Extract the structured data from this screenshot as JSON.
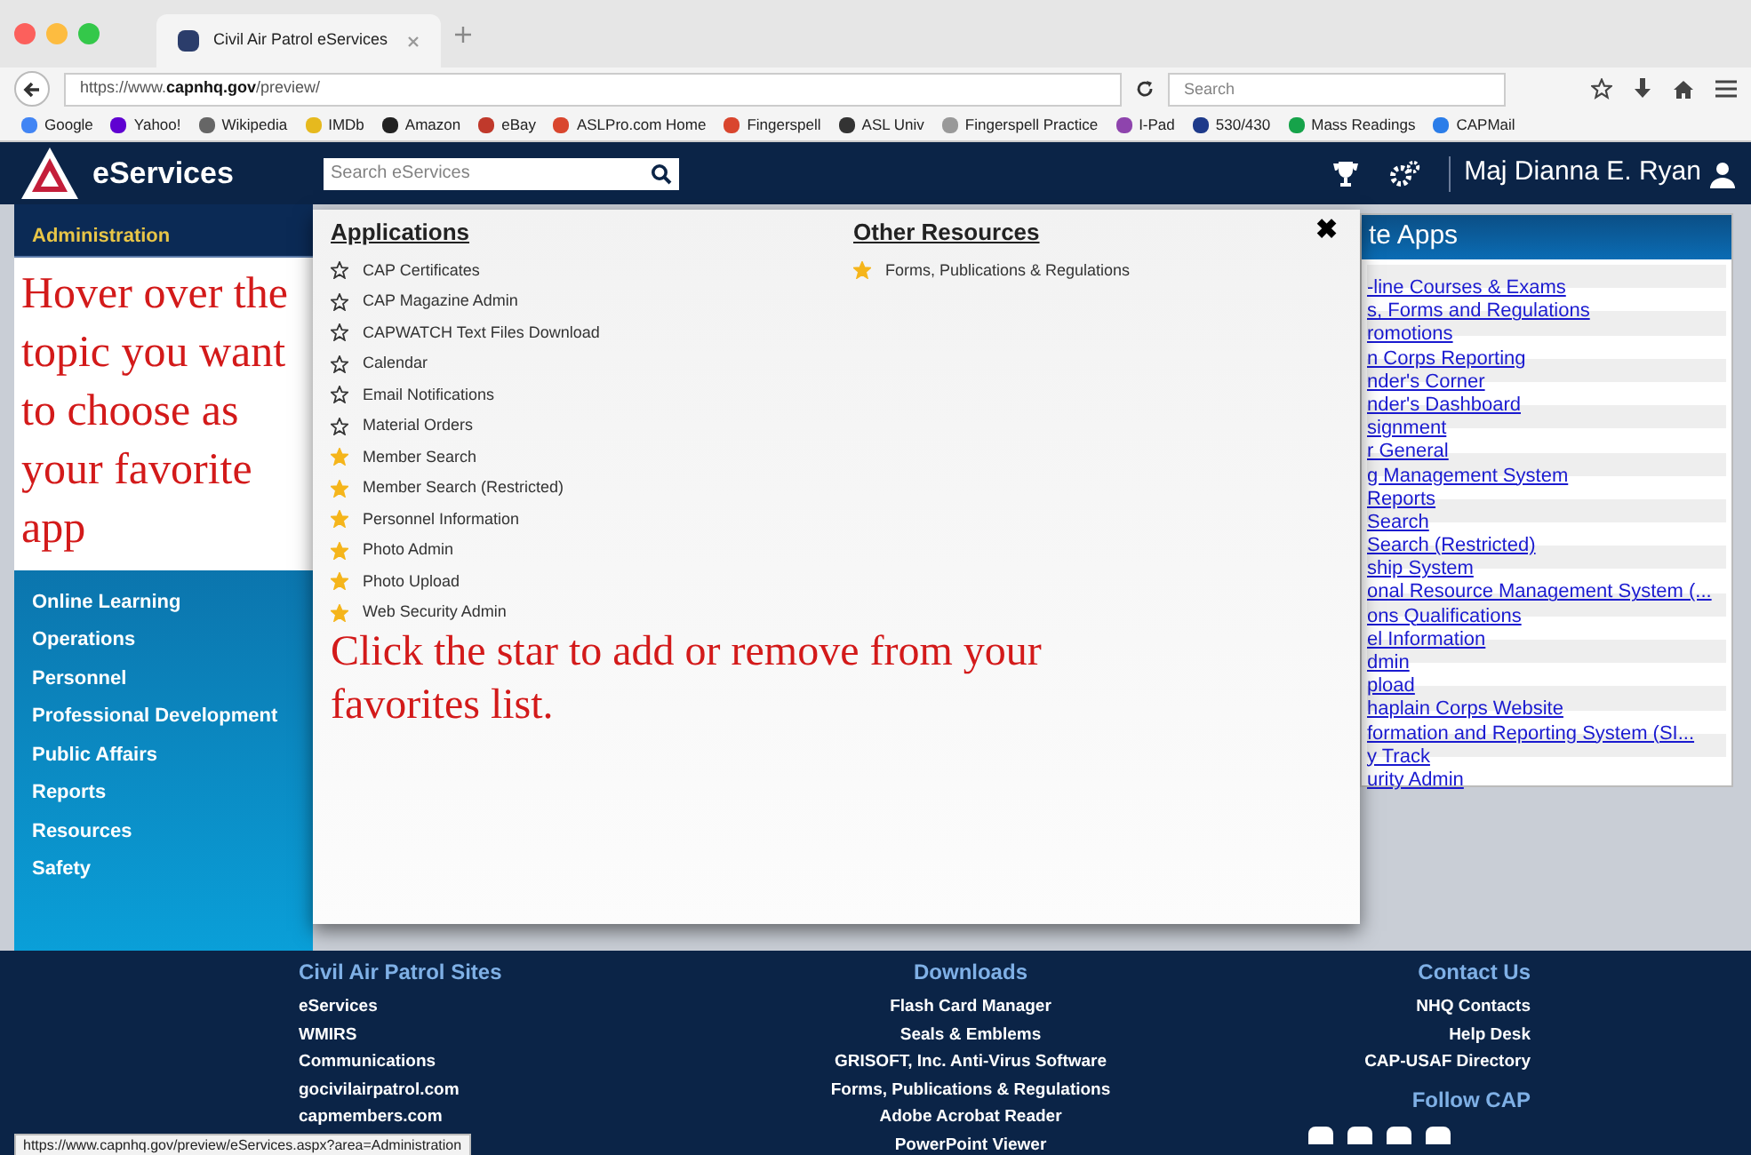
{
  "browser": {
    "tab": {
      "title": "Civil Air Patrol eServices",
      "selected": true
    },
    "url_prefix": "https://www.",
    "url_host": "capnhq.gov",
    "url_path": "/preview/",
    "search_placeholder": "Search",
    "bookmarks": [
      "Google",
      "Yahoo!",
      "Wikipedia",
      "IMDb",
      "Amazon",
      "eBay",
      "ASLPro.com Home",
      "Fingerspell",
      "ASL Univ",
      "Fingerspell Practice",
      "I-Pad",
      "530/430",
      "Mass Readings",
      "CAPMail"
    ]
  },
  "header": {
    "logo": "eServices",
    "search_placeholder": "Search eServices",
    "user": "Maj Dianna E. Ryan"
  },
  "sidebar": {
    "items": [
      {
        "label": "Administration",
        "selected": true
      },
      {
        "label": "Online Learning",
        "selected": false
      },
      {
        "label": "Operations",
        "selected": false
      },
      {
        "label": "Personnel",
        "selected": false
      },
      {
        "label": "Professional Development",
        "selected": false
      },
      {
        "label": "Public Affairs",
        "selected": false
      },
      {
        "label": "Reports",
        "selected": false
      },
      {
        "label": "Resources",
        "selected": false
      },
      {
        "label": "Safety",
        "selected": false
      }
    ]
  },
  "hover_note": "Hover over the topic you want to choose as your favorite app",
  "menu": {
    "applications": {
      "title": "Applications",
      "items": [
        {
          "label": "CAP Certificates",
          "favorite": false
        },
        {
          "label": "CAP Magazine Admin",
          "favorite": false
        },
        {
          "label": "CAPWATCH Text Files Download",
          "favorite": false
        },
        {
          "label": "Calendar",
          "favorite": false
        },
        {
          "label": "Email Notifications",
          "favorite": false
        },
        {
          "label": "Material Orders",
          "favorite": false
        },
        {
          "label": "Member Search",
          "favorite": true
        },
        {
          "label": "Member Search (Restricted)",
          "favorite": true
        },
        {
          "label": "Personnel Information",
          "favorite": true
        },
        {
          "label": "Photo Admin",
          "favorite": true
        },
        {
          "label": "Photo Upload",
          "favorite": true
        },
        {
          "label": "Web Security Admin",
          "favorite": true
        }
      ]
    },
    "other_resources": {
      "title": "Other Resources",
      "items": [
        {
          "label": "Forms, Publications & Regulations",
          "favorite": true
        }
      ]
    },
    "close": "✖",
    "star_note": "Click the star to add or remove from your favorites list."
  },
  "favorite_apps": {
    "title": "te Apps",
    "items": [
      "-line Courses & Exams",
      "s, Forms and Regulations",
      "romotions",
      "n Corps Reporting",
      "nder's Corner",
      "nder's Dashboard",
      "signment",
      "r General",
      "g Management System",
      "Reports",
      "Search",
      "Search (Restricted)",
      "ship System",
      "onal Resource Management System (...",
      "ons Qualifications",
      "el Information",
      "dmin",
      "pload",
      "haplain Corps Website",
      "formation and Reporting System (SI...",
      "y Track",
      "urity Admin"
    ]
  },
  "footer": {
    "columns": [
      {
        "title": "Civil Air Patrol Sites",
        "links": [
          "eServices",
          "WMIRS",
          "Communications",
          "gocivilairpatrol.com",
          "capmembers.com"
        ]
      },
      {
        "title": "Downloads",
        "links": [
          "Flash Card Manager",
          "Seals & Emblems",
          "GRISOFT, Inc. Anti-Virus Software",
          "Forms, Publications & Regulations",
          "Adobe Acrobat Reader",
          "PowerPoint Viewer"
        ]
      },
      {
        "title": "Contact Us",
        "links": [
          "NHQ Contacts",
          "Help Desk",
          "CAP-USAF Directory"
        ],
        "follow_title": "Follow CAP"
      }
    ]
  },
  "status_url": "https://www.capnhq.gov/preview/eServices.aspx?area=Administration"
}
